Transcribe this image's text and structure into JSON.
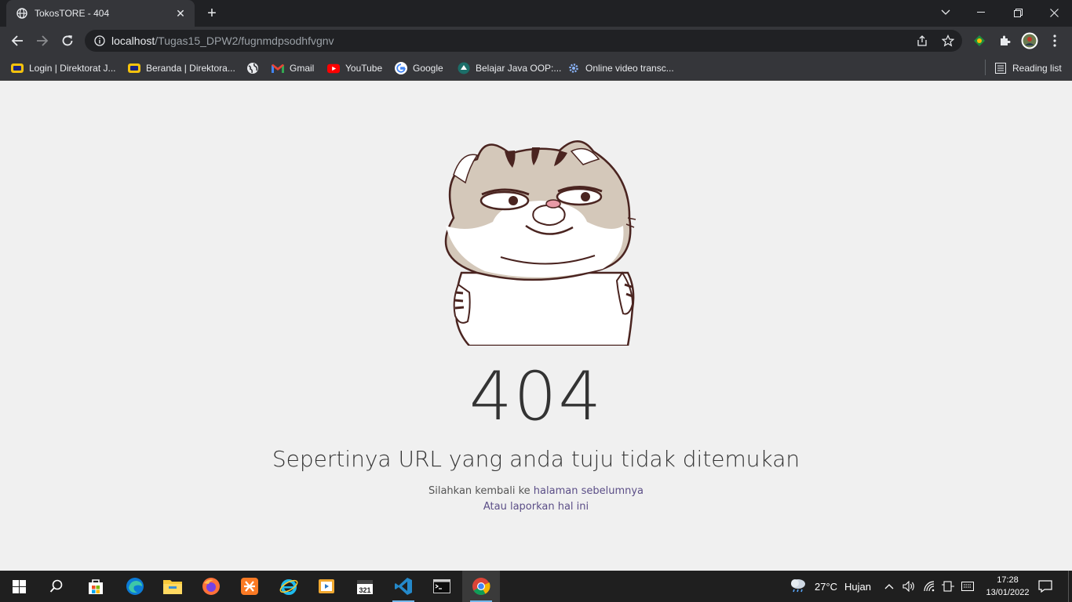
{
  "browser": {
    "tab_title": "TokosTORE - 404",
    "url_host": "localhost",
    "url_path": "/Tugas15_DPW2/fugnmdpsodhfvgnv",
    "reading_list": "Reading list"
  },
  "bookmarks": [
    {
      "label": "Login | Direktorat J...",
      "icon": "folder-yellow-icon"
    },
    {
      "label": "Beranda | Direktora...",
      "icon": "folder-yellow-icon"
    },
    {
      "label": "",
      "icon": "globe-icon"
    },
    {
      "label": "Gmail",
      "icon": "gmail-icon"
    },
    {
      "label": "YouTube",
      "icon": "youtube-icon"
    },
    {
      "label": "Google",
      "icon": "google-icon"
    },
    {
      "label": "Belajar Java OOP:...",
      "icon": "site-icon"
    },
    {
      "label": "Online video transc...",
      "icon": "gear-icon"
    }
  ],
  "page": {
    "code": "404",
    "message": "Sepertinya URL yang anda tuju tidak ditemukan",
    "line1_prefix": "Silahkan kembali ke ",
    "line1_link": "halaman sebelumnya",
    "line2_link": "Atau laporkan hal ini"
  },
  "taskbar": {
    "weather_temp": "27°C",
    "weather_label": "Hujan",
    "time": "17:28",
    "date": "13/01/2022"
  },
  "colors": {
    "chrome_dark": "#202124",
    "chrome_toolbar": "#35363a",
    "page_bg": "#f0f0f0",
    "link": "#5b4e87",
    "taskbar": "#1f1f1f"
  }
}
